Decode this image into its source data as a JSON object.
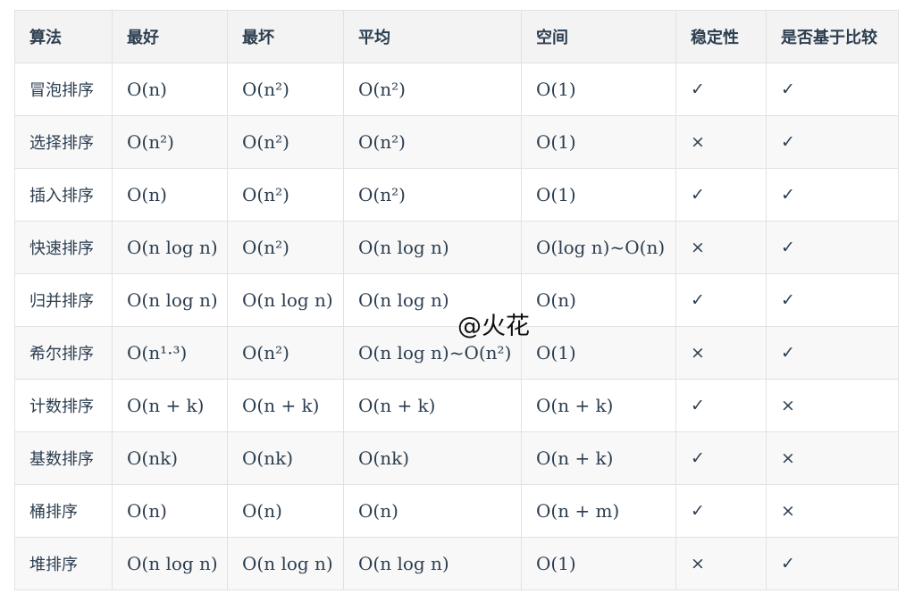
{
  "table": {
    "headers": [
      "算法",
      "最好",
      "最坏",
      "平均",
      "空间",
      "稳定性",
      "是否基于比较"
    ],
    "rows": [
      [
        "冒泡排序",
        "O(n)",
        "O(n²)",
        "O(n²)",
        "O(1)",
        "✓",
        "✓"
      ],
      [
        "选择排序",
        "O(n²)",
        "O(n²)",
        "O(n²)",
        "O(1)",
        "×",
        "✓"
      ],
      [
        "插入排序",
        "O(n)",
        "O(n²)",
        "O(n²)",
        "O(1)",
        "✓",
        "✓"
      ],
      [
        "快速排序",
        "O(n log n)",
        "O(n²)",
        "O(n log n)",
        "O(log n)~O(n)",
        "×",
        "✓"
      ],
      [
        "归并排序",
        "O(n log n)",
        "O(n log n)",
        "O(n log n)",
        "O(n)",
        "✓",
        "✓"
      ],
      [
        "希尔排序",
        "O(n¹·³)",
        "O(n²)",
        "O(n log n)~O(n²)",
        "O(1)",
        "×",
        "✓"
      ],
      [
        "计数排序",
        "O(n + k)",
        "O(n + k)",
        "O(n + k)",
        "O(n + k)",
        "✓",
        "×"
      ],
      [
        "基数排序",
        "O(nk)",
        "O(nk)",
        "O(nk)",
        "O(n + k)",
        "✓",
        "×"
      ],
      [
        "桶排序",
        "O(n)",
        "O(n)",
        "O(n)",
        "O(n + m)",
        "✓",
        "×"
      ],
      [
        "堆排序",
        "O(n log n)",
        "O(n log n)",
        "O(n log n)",
        "O(1)",
        "×",
        "✓"
      ]
    ]
  },
  "watermark": "@火花"
}
